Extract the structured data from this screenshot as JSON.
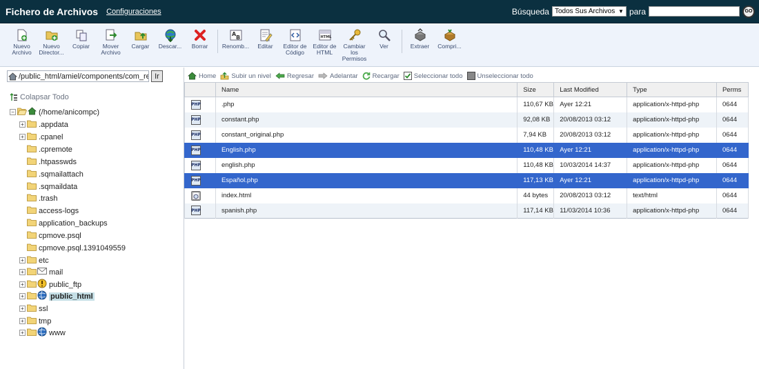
{
  "header": {
    "title": "Fichero de Archivos",
    "config_link": "Configuraciones",
    "search_label": "Búsqueda",
    "search_scope": "Todos Sus Archivos",
    "search_para": "para",
    "search_value": "",
    "go_label": "GO"
  },
  "toolbar": {
    "buttons": [
      {
        "label": "Nuevo\nArchivo",
        "icon": "new-file-icon"
      },
      {
        "label": "Nuevo\nDirector...",
        "icon": "new-folder-icon"
      },
      {
        "label": "Copiar",
        "icon": "copy-icon"
      },
      {
        "label": "Mover\nArchivo",
        "icon": "move-icon"
      },
      {
        "label": "Cargar",
        "icon": "upload-icon"
      },
      {
        "label": "Descar...",
        "icon": "download-icon"
      },
      {
        "label": "Borrar",
        "icon": "delete-icon"
      },
      {
        "label": "Renomb...",
        "icon": "rename-icon"
      },
      {
        "label": "Editar",
        "icon": "edit-icon"
      },
      {
        "label": "Editor de\nCódigo",
        "icon": "code-editor-icon"
      },
      {
        "label": "Editor de\nHTML",
        "icon": "html-editor-icon"
      },
      {
        "label": "Cambiar\nlos\nPermisos",
        "icon": "permissions-icon"
      },
      {
        "label": "Ver",
        "icon": "view-icon"
      },
      {
        "label": "Extraer",
        "icon": "extract-icon"
      },
      {
        "label": "Compri...",
        "icon": "compress-icon"
      }
    ]
  },
  "leftpanel": {
    "path": "/public_html/amiel/components/com_rea",
    "ir_label": "Ir",
    "collapse_all": "Colapsar Todo",
    "tree": [
      {
        "label": "(/home/anicompc)",
        "expander": "minus",
        "icon": "home-icon"
      },
      {
        "label": ".appdata",
        "expander": "plus",
        "icon": "folder-icon"
      },
      {
        "label": ".cpanel",
        "expander": "plus",
        "icon": "folder-icon"
      },
      {
        "label": ".cpremote",
        "expander": "none",
        "icon": "folder-icon"
      },
      {
        "label": ".htpasswds",
        "expander": "none",
        "icon": "folder-icon"
      },
      {
        "label": ".sqmailattach",
        "expander": "none",
        "icon": "folder-icon"
      },
      {
        "label": ".sqmaildata",
        "expander": "none",
        "icon": "folder-icon"
      },
      {
        "label": ".trash",
        "expander": "none",
        "icon": "folder-icon"
      },
      {
        "label": "access-logs",
        "expander": "none",
        "icon": "folder-icon"
      },
      {
        "label": "application_backups",
        "expander": "none",
        "icon": "folder-icon"
      },
      {
        "label": "cpmove.psql",
        "expander": "none",
        "icon": "folder-icon"
      },
      {
        "label": "cpmove.psql.1391049559",
        "expander": "none",
        "icon": "folder-icon"
      },
      {
        "label": "etc",
        "expander": "plus",
        "icon": "folder-icon"
      },
      {
        "label": "mail",
        "expander": "plus",
        "icon": "mail-icon"
      },
      {
        "label": "public_ftp",
        "expander": "plus",
        "icon": "ftp-icon"
      },
      {
        "label": "public_html",
        "expander": "plus",
        "icon": "globe-icon",
        "selected": true
      },
      {
        "label": "ssl",
        "expander": "plus",
        "icon": "folder-icon"
      },
      {
        "label": "tmp",
        "expander": "plus",
        "icon": "folder-icon"
      },
      {
        "label": "www",
        "expander": "plus",
        "icon": "globe-icon"
      }
    ]
  },
  "nav": {
    "items": [
      {
        "label": "Home",
        "icon": "home-icon"
      },
      {
        "label": "Subir un nivel",
        "icon": "up-level-icon"
      },
      {
        "label": "Regresar",
        "icon": "back-arrow-icon"
      },
      {
        "label": "Adelantar",
        "icon": "forward-arrow-icon"
      },
      {
        "label": "Recargar",
        "icon": "reload-icon"
      },
      {
        "label": "Seleccionar todo",
        "icon": "select-all-icon"
      },
      {
        "label": "Unseleccionar todo",
        "icon": "unselect-all-icon"
      }
    ]
  },
  "table": {
    "columns": [
      "Name",
      "Size",
      "Last Modified",
      "Type",
      "Perms"
    ],
    "rows": [
      {
        "name": ".php",
        "size": "110,67 KB",
        "modified": "Ayer 12:21",
        "type": "application/x-httpd-php",
        "perms": "0644",
        "icon": "php-file-icon",
        "selected": false
      },
      {
        "name": "constant.php",
        "size": "92,08 KB",
        "modified": "20/08/2013 03:12",
        "type": "application/x-httpd-php",
        "perms": "0644",
        "icon": "php-file-icon",
        "selected": false
      },
      {
        "name": "constant_original.php",
        "size": "7,94 KB",
        "modified": "20/08/2013 03:12",
        "type": "application/x-httpd-php",
        "perms": "0644",
        "icon": "php-file-icon",
        "selected": false
      },
      {
        "name": "English.php",
        "size": "110,48 KB",
        "modified": "Ayer 12:21",
        "type": "application/x-httpd-php",
        "perms": "0644",
        "icon": "php-file-icon",
        "selected": true
      },
      {
        "name": "english.php",
        "size": "110,48 KB",
        "modified": "10/03/2014 14:37",
        "type": "application/x-httpd-php",
        "perms": "0644",
        "icon": "php-file-icon",
        "selected": false
      },
      {
        "name": "Español.php",
        "size": "117,13 KB",
        "modified": "Ayer 12:21",
        "type": "application/x-httpd-php",
        "perms": "0644",
        "icon": "php-file-icon",
        "selected": true
      },
      {
        "name": "index.html",
        "size": "44 bytes",
        "modified": "20/08/2013 03:12",
        "type": "text/html",
        "perms": "0644",
        "icon": "html-file-icon",
        "selected": false
      },
      {
        "name": "spanish.php",
        "size": "117,14 KB",
        "modified": "11/03/2014 10:36",
        "type": "application/x-httpd-php",
        "perms": "0644",
        "icon": "php-file-icon",
        "selected": false
      }
    ]
  },
  "colors": {
    "header_bg": "#0b3040",
    "toolbar_bg": "#eef3fb",
    "selection": "#3366cc",
    "tree_selection": "#c5dfe6"
  }
}
